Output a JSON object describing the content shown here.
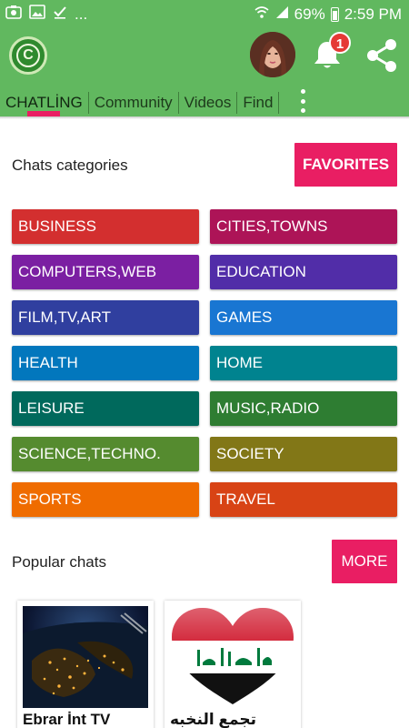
{
  "status_bar": {
    "left_icons": [
      "gallery-icon",
      "image-icon",
      "check-icon"
    ],
    "more_indicator": "...",
    "battery": "69%",
    "time": "2:59 PM"
  },
  "app_bar": {
    "logo_letter": "C",
    "notification_count": "1",
    "tabs": [
      {
        "label": "CHATLİNG"
      },
      {
        "label": "Community"
      },
      {
        "label": "Videos"
      },
      {
        "label": "Find"
      }
    ]
  },
  "categories_section": {
    "title": "Chats categories",
    "favorites_label": "FAVORITES",
    "items": [
      {
        "label": "BUSINESS",
        "color": "#d32f2f"
      },
      {
        "label": "CITIES,TOWNS",
        "color": "#ad1457"
      },
      {
        "label": "COMPUTERS,WEB",
        "color": "#7b1fa2"
      },
      {
        "label": "EDUCATION",
        "color": "#512da8"
      },
      {
        "label": "FILM,TV,ART",
        "color": "#303f9f"
      },
      {
        "label": "GAMES",
        "color": "#1976d2"
      },
      {
        "label": "HEALTH",
        "color": "#0277bd"
      },
      {
        "label": "HOME",
        "color": "#00838f"
      },
      {
        "label": "LEISURE",
        "color": "#00695c"
      },
      {
        "label": "MUSIC,RADIO",
        "color": "#2e7d32"
      },
      {
        "label": "SCIENCE,TECHNO.",
        "color": "#558b2f"
      },
      {
        "label": "SOCIETY",
        "color": "#827717"
      },
      {
        "label": "SPORTS",
        "color": "#ef6c00"
      },
      {
        "label": "TRAVEL",
        "color": "#d84315"
      }
    ]
  },
  "popular_section": {
    "title": "Popular chats",
    "more_label": "MORE",
    "chats": [
      {
        "name": "Ebrar İnt TV"
      },
      {
        "name": "تجمع النخبه"
      }
    ]
  },
  "colors": {
    "app_bar": "#61b85f",
    "accent": "#e91e63"
  }
}
